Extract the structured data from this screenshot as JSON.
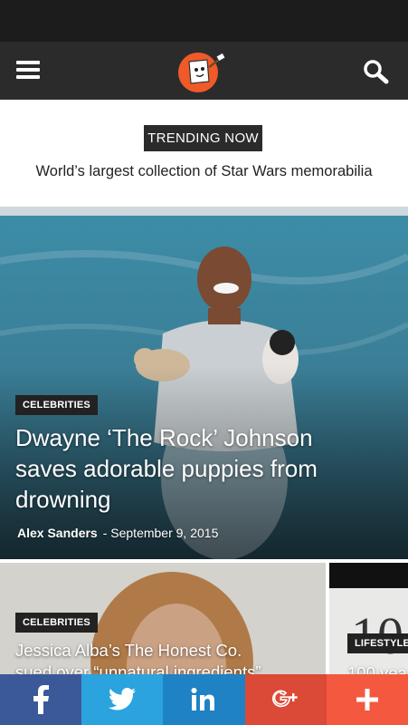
{
  "colors": {
    "status_bar": "#1c1c1c",
    "app_bar": "#2b2b2b",
    "facebook": "#3b5998",
    "twitter": "#2aa3de",
    "linkedin": "#1f82c4",
    "google_plus": "#db4a36",
    "more": "#f4583e"
  },
  "header": {
    "menu_icon": "hamburger-icon",
    "logo_icon": "marshmallow-mascot-logo",
    "search_icon": "search-icon"
  },
  "trending": {
    "badge": "TRENDING NOW",
    "headline": "World’s largest collection of Star Wars memorabilia"
  },
  "hero": {
    "category": "CELEBRITIES",
    "title_lines": [
      "Dwayne ‘The Rock’ Johnson",
      "saves adorable puppies from",
      "drowning"
    ],
    "author": "Alex Sanders",
    "date": "- September 9, 2015"
  },
  "cards": [
    {
      "category": "CELEBRITIES",
      "title_line1": "Jessica Alba’s The Honest Co.",
      "title_line2": "sued over “unnatural ingredients”"
    },
    {
      "category": "LIFESTYLE",
      "title_line1": "100 yea"
    }
  ],
  "share_bar": [
    {
      "label": "f",
      "icon": "facebook-icon"
    },
    {
      "label": "",
      "icon": "twitter-icon"
    },
    {
      "label": "in",
      "icon": "linkedin-icon"
    },
    {
      "label": "g+",
      "icon": "google-plus-icon"
    },
    {
      "label": "+",
      "icon": "plus-icon"
    }
  ]
}
